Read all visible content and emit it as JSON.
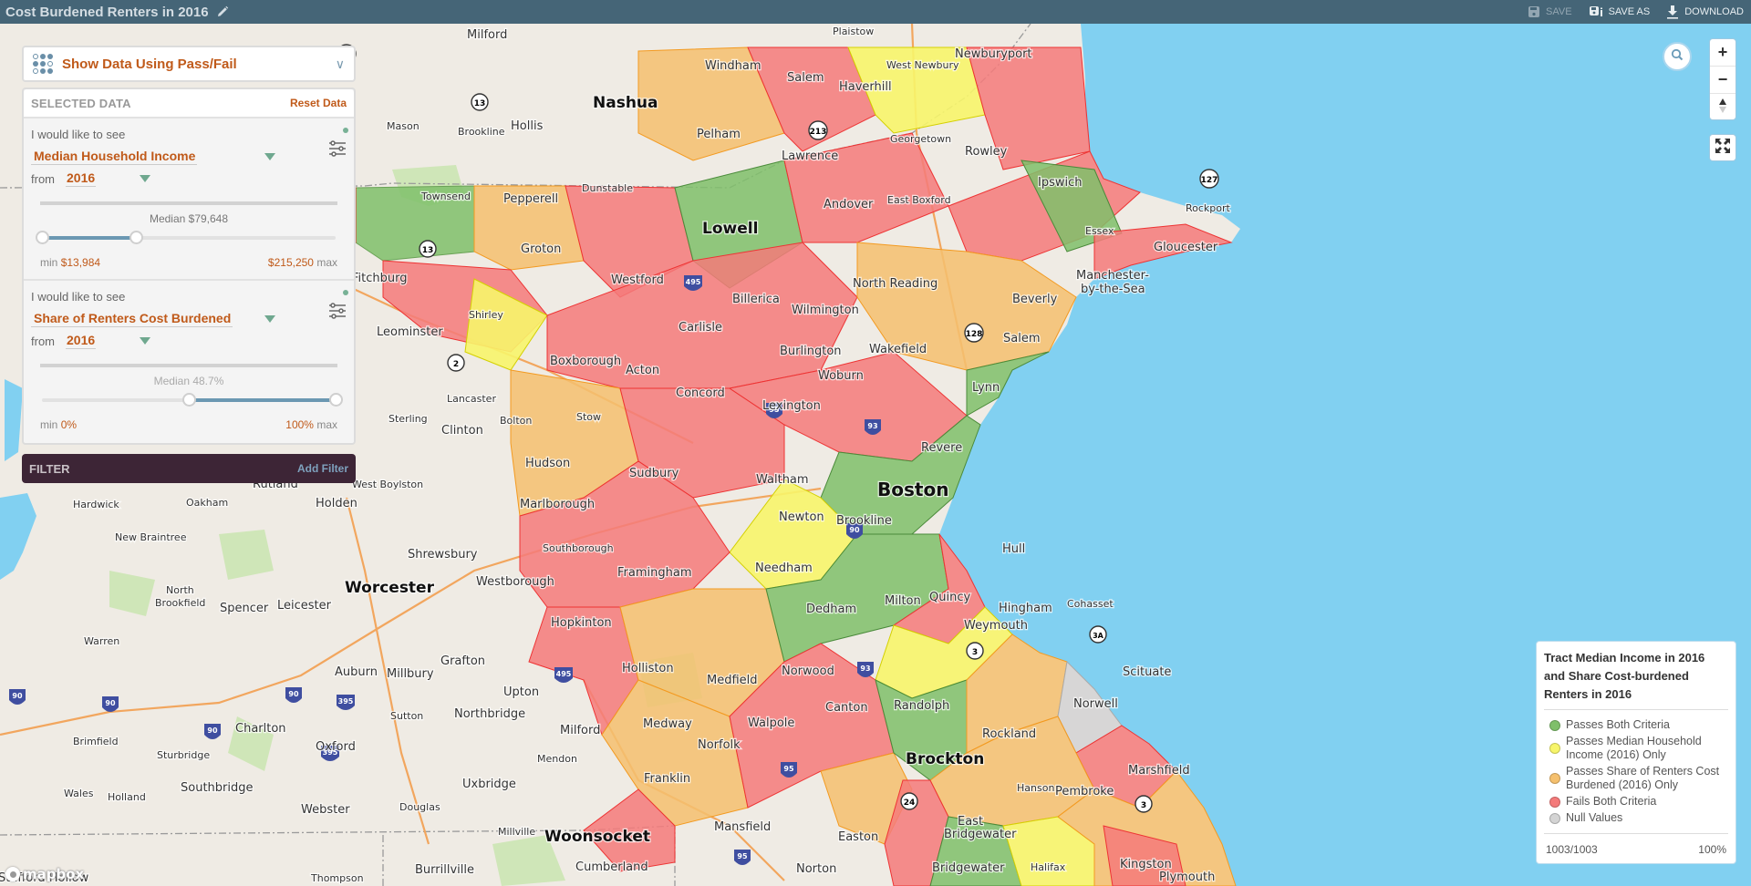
{
  "header": {
    "title": "Cost Burdened Renters in 2016",
    "actions": [
      {
        "label": "SAVE",
        "icon": "floppy-disk-icon",
        "enabled": false
      },
      {
        "label": "SAVE AS",
        "icon": "save-as-icon",
        "enabled": true
      },
      {
        "label": "DOWNLOAD",
        "icon": "download-icon",
        "enabled": true
      }
    ]
  },
  "display_mode": {
    "label": "Show Data Using Pass/Fail",
    "icon": "dot-grid-icon"
  },
  "selected_data": {
    "title": "SELECTED DATA",
    "reset_label": "Reset Data",
    "variables": [
      {
        "prompt": "I would like to see",
        "variable": "Median Household Income",
        "from_label": "from",
        "year": "2016",
        "median_label": "Median $79,648",
        "range_min_fraction": 0.0,
        "range_max_fraction": 0.32,
        "min_label": "min",
        "min_value": "$13,984",
        "max_value": "$215,250",
        "max_label": "max"
      },
      {
        "prompt": "I would like to see",
        "variable": "Share of Renters Cost Burdened",
        "from_label": "from",
        "year": "2016",
        "median_label": "Median 48.7%",
        "range_min_fraction": 0.5,
        "range_max_fraction": 1.0,
        "min_label": "min",
        "min_value": "0%",
        "max_value": "100%",
        "max_label": "max"
      }
    ]
  },
  "filter": {
    "title": "FILTER",
    "add_label": "Add Filter"
  },
  "map_controls": {
    "search": "search-icon",
    "zoom_in": "+",
    "zoom_out": "−",
    "compass": "compass-icon",
    "fullscreen": "fullscreen-icon"
  },
  "legend": {
    "title": "Tract Median Income in 2016 and Share Cost-burdened Renters in 2016",
    "items": [
      {
        "label": "Passes Both Criteria",
        "color": "#7fbf6a"
      },
      {
        "label": "Passes Median Household Income (2016) Only",
        "color": "#f7f56a"
      },
      {
        "label": "Passes Share of Renters Cost Burdened (2016) Only",
        "color": "#f5c06e"
      },
      {
        "label": "Fails Both Criteria",
        "color": "#f47a7a"
      },
      {
        "label": "Null Values",
        "color": "#d4d4d4"
      }
    ],
    "count": "1003/1003",
    "percent": "100%"
  },
  "colors": {
    "pass_both": "#7fbf6a",
    "pass_income": "#f7f56a",
    "pass_burden": "#f5c06e",
    "fail_both": "#f47a7a",
    "null": "#d4d4d4",
    "water": "#81d0f1",
    "land": "#efebe4",
    "accent": "#c05a1a"
  },
  "map_labels": {
    "cities": [
      "Boston",
      "Worcester",
      "Nashua",
      "Lowell",
      "Brockton",
      "Woonsocket"
    ],
    "towns": [
      "Milford",
      "Windham",
      "Salem",
      "Plaistow",
      "Newburyport",
      "West Newbury",
      "Haverhill",
      "Hollis",
      "Mason",
      "Brookline",
      "Pelham",
      "Lawrence",
      "Georgetown",
      "Rowley",
      "Andover",
      "East Boxford",
      "Ipswich",
      "Pepperell",
      "Dunstable",
      "Townsend",
      "Essex",
      "Gloucester",
      "Rockport",
      "Groton",
      "Westford",
      "Billerica",
      "North Reading",
      "Manchester-by-the-Sea",
      "Beverly",
      "Fitchburg",
      "Shirley",
      "Carlisle",
      "Wilmington",
      "Leominster",
      "Salem",
      "Boxborough",
      "Acton",
      "Burlington",
      "Wakefield",
      "Lancaster",
      "Concord",
      "Woburn",
      "Lynn",
      "Sterling",
      "Clinton",
      "Bolton",
      "Stow",
      "Lexington",
      "Revere",
      "Rutland",
      "Hudson",
      "Sudbury",
      "Waltham",
      "West Boylston",
      "Hardwick",
      "Oakham",
      "Holden",
      "Marlborough",
      "Newton",
      "Brookline",
      "New Braintree",
      "Shrewsbury",
      "Southborough",
      "Framingham",
      "Needham",
      "Hull",
      "North Brookfield",
      "Westborough",
      "Dedham",
      "Milton",
      "Quincy",
      "Hingham",
      "Cohasset",
      "Spencer",
      "Leicester",
      "Hopkinton",
      "Weymouth",
      "Warren",
      "Grafton",
      "Holliston",
      "Medfield",
      "Norwood",
      "Scituate",
      "Auburn",
      "Millbury",
      "Upton",
      "Randolph",
      "Norwell",
      "Charlton",
      "Northbridge",
      "Medway",
      "Walpole",
      "Canton",
      "Brimfield",
      "Oxford",
      "Sutton",
      "Milford",
      "Norfolk",
      "Rockland",
      "Sturbridge",
      "Mendon",
      "Marshfield",
      "Southbridge",
      "Uxbridge",
      "Franklin",
      "Hanson",
      "Pembroke",
      "Wales",
      "Holland",
      "Webster",
      "Douglas",
      "Millville",
      "East Bridgewater",
      "Mansfield",
      "Easton",
      "Bridgewater",
      "Halifax",
      "Kingston",
      "Burrillville",
      "Cumberland",
      "Norton",
      "Thompson",
      "Plymouth",
      "Stafford Hollow"
    ]
  },
  "attribution": "mapbox"
}
